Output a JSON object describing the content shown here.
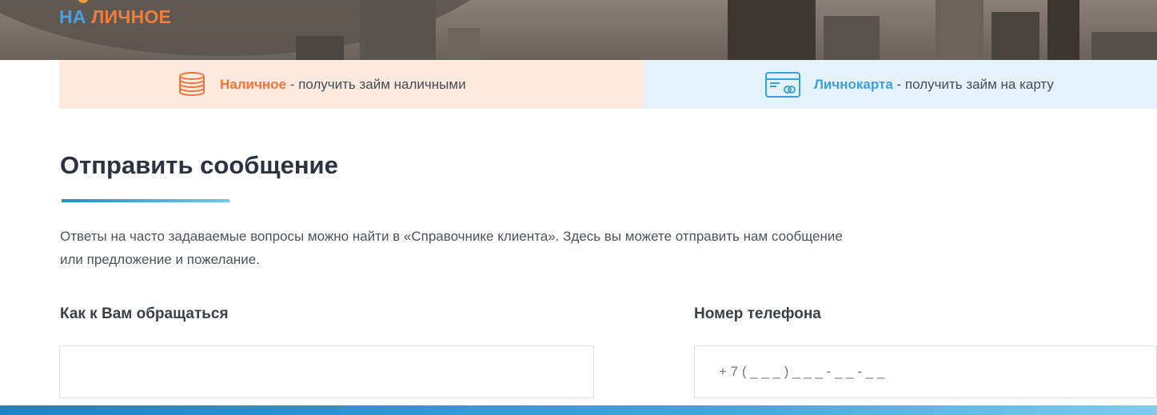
{
  "header": {
    "logo_line1": "НА",
    "logo_line2": "ЛИЧНОЕ"
  },
  "banners": {
    "left": {
      "icon": "coins-icon",
      "brand": "Наличное",
      "text": " - получить займ наличными"
    },
    "right": {
      "icon": "credit-card-icon",
      "brand": "Личнокарта",
      "text": " - получить займ на карту"
    }
  },
  "main": {
    "title": "Отправить сообщение",
    "description": "Ответы на часто задаваемые вопросы можно найти в «Справочнике клиента». Здесь вы можете отправить нам сообщение или предложение и пожелание."
  },
  "form": {
    "name_label": "Как к Вам обращаться",
    "name_value": "",
    "phone_label": "Номер телефона",
    "phone_placeholder": "+ 7 ( _ _ _ ) _ _ _ - _ _ - _ _"
  },
  "colors": {
    "orange": "#f0763b",
    "blue": "#3f9fd8",
    "title": "#2b3240"
  }
}
